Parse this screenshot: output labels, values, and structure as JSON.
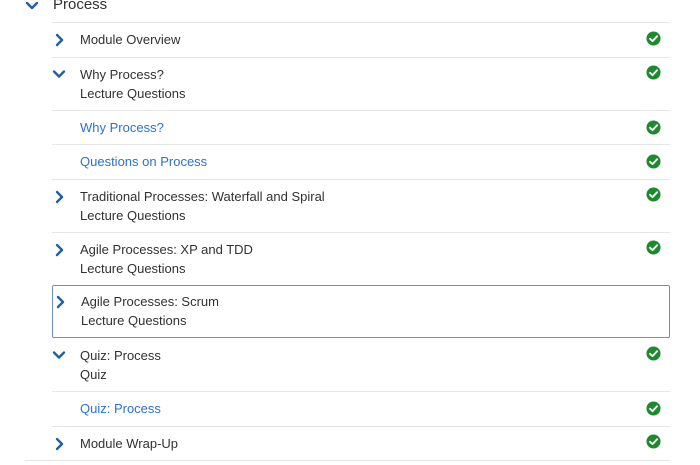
{
  "section": {
    "title": "Process",
    "expanded": true
  },
  "items": [
    {
      "type": "lesson",
      "title": "Module Overview",
      "subtitle": "",
      "expanded": false,
      "completed": true
    },
    {
      "type": "lesson",
      "title": "Why Process?",
      "subtitle": "Lecture Questions",
      "expanded": true,
      "completed": true
    },
    {
      "type": "link",
      "title": "Why Process?",
      "completed": true
    },
    {
      "type": "link",
      "title": "Questions on Process",
      "completed": true
    },
    {
      "type": "lesson",
      "title": "Traditional Processes: Waterfall and Spiral",
      "subtitle": "Lecture Questions",
      "expanded": false,
      "completed": true
    },
    {
      "type": "lesson",
      "title": "Agile Processes: XP and TDD",
      "subtitle": "Lecture Questions",
      "expanded": false,
      "completed": true
    },
    {
      "type": "lesson",
      "title": "Agile Processes: Scrum",
      "subtitle": "Lecture Questions",
      "expanded": false,
      "completed": false,
      "focused": true
    },
    {
      "type": "lesson",
      "title": "Quiz: Process",
      "subtitle": "Quiz",
      "expanded": true,
      "completed": true
    },
    {
      "type": "link",
      "title": "Quiz: Process",
      "completed": true
    },
    {
      "type": "lesson",
      "title": "Module Wrap-Up",
      "subtitle": "",
      "expanded": false,
      "completed": true
    }
  ],
  "colors": {
    "accent": "#1f5fa8",
    "link": "#2a73cc",
    "check": "#1e8a2e",
    "focus_border": "#6f8bd6"
  },
  "icons": {
    "expanded": "chevron-down-icon",
    "collapsed": "chevron-right-icon",
    "completed": "check-circle-icon"
  }
}
